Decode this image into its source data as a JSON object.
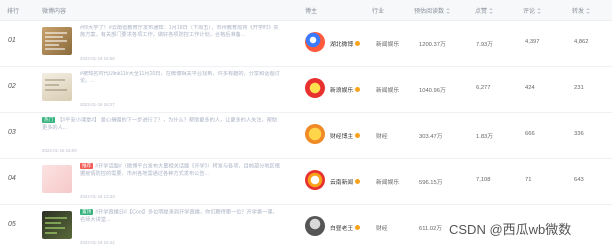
{
  "header": {
    "rank": "排行",
    "post": "微博内容",
    "blogger": "博主",
    "industry": "行业",
    "reads": "预估阅读数",
    "shares": "点赞",
    "comments": "评论",
    "likes": "转发"
  },
  "rows": [
    {
      "rank": "01",
      "tag": "",
      "text": "#你大学了！#云南省教育厅发布通知：1月18日（下周五），市州教育局将《开学时》实施方案，有关部门要求各项工作，做好各项防控工作计划，合格后准备...",
      "meta": "2022-01-18 16:58",
      "blogger": "湖北微博",
      "industry": "新闻娱乐",
      "reads": "1200.37万",
      "shares": "7.93万",
      "comments": "4,397",
      "likes": "4,862"
    },
    {
      "rank": "02",
      "tag": "",
      "text": "#被知名时代Ulink11#大全11月20日，在微博相关平台找到，许多有趣的，分享和话题讨论。...",
      "meta": "2022-01-16 16:27",
      "blogger": "新浪娱乐",
      "industry": "新闻娱乐",
      "reads": "1040.96万",
      "shares": "6,277",
      "comments": "424",
      "likes": "231"
    },
    {
      "rank": "03",
      "tag": "热门",
      "text": "【#平安小课堂#】 爱心捐赠的下一步进行了？，为什么？帮助更多的人，让更多的人关注，帮助更多的人...",
      "meta": "2022-01-16 16:09",
      "blogger": "财经博主",
      "industry": "财经",
      "reads": "303.47万",
      "shares": "1.83万",
      "comments": "666",
      "likes": "336"
    },
    {
      "rank": "04",
      "tag": "推荐",
      "text": "#开学话题#（微博平台发布大量相关话题《开学》）转发与各项，目前部分地区根据疫情防控的需要，市州各地需通过各种方式发布公告...",
      "meta": "2022-01-16 13:33",
      "blogger": "云南新闻",
      "industry": "新闻娱乐",
      "reads": "596.15万",
      "shares": "7,108",
      "comments": "71",
      "likes": "643"
    },
    {
      "rank": "05",
      "tag": "置顶",
      "text": "#开学直播日#【Cool】多位明星来到开学直播，你们期待哪一位？开学第一课，名师大讲堂...",
      "meta": "2022-01-18 15:42",
      "blogger": "白昼老王",
      "industry": "财经",
      "reads": "611.02万",
      "shares": "",
      "comments": "",
      "likes": ""
    }
  ],
  "watermark": "CSDN @西瓜wb微数",
  "colors": {
    "accent": "#3a7afe",
    "tag_hot": "#36b37e",
    "tag_rec": "#f25c54",
    "verified": "#f7a21b"
  }
}
